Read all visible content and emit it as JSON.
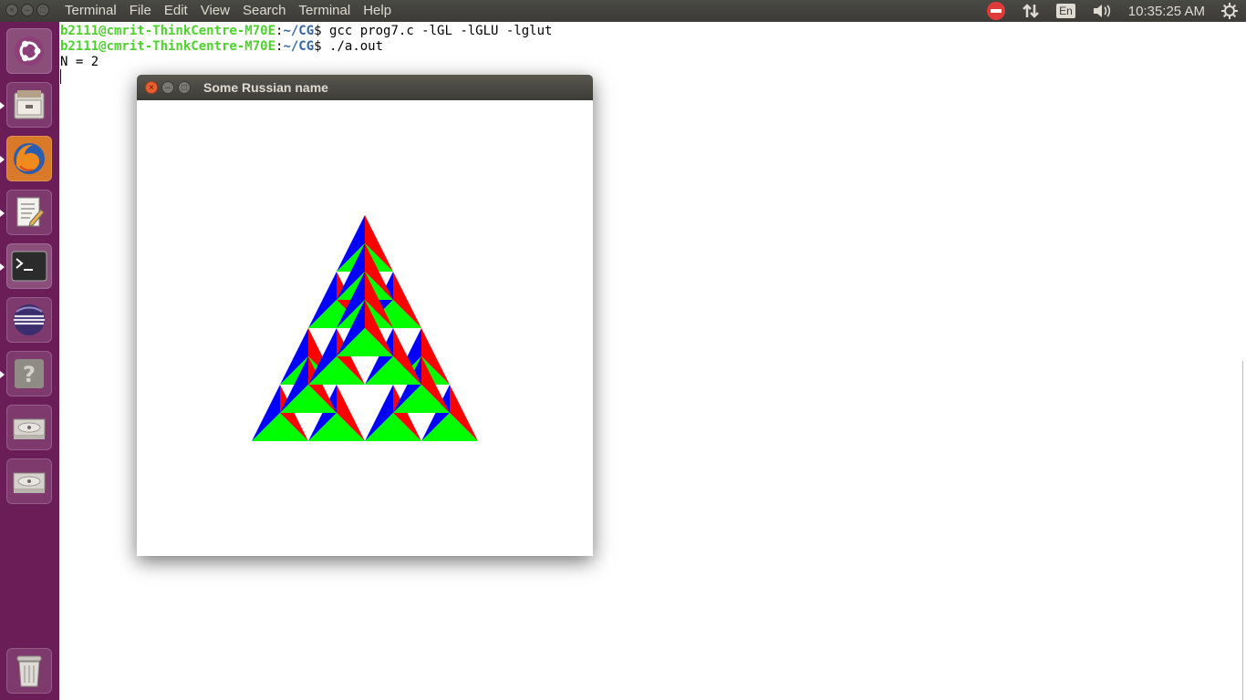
{
  "top_panel": {
    "menus": [
      "Terminal",
      "File",
      "Edit",
      "View",
      "Search",
      "Terminal",
      "Help"
    ],
    "language": "En",
    "clock": "10:35:25 AM"
  },
  "launcher": {
    "items": [
      "ubuntu-dash-icon",
      "files-icon",
      "firefox-icon",
      "text-editor-icon",
      "terminal-icon",
      "eclipse-icon",
      "help-icon",
      "drive-icon",
      "drive-icon",
      "trash-icon"
    ]
  },
  "terminal": {
    "lines": [
      {
        "user": "b2111@cmrit-ThinkCentre-M70E",
        "sep": ":",
        "path": "~/CG",
        "prompt": "$ ",
        "command": "gcc prog7.c -lGL -lGLU -lglut"
      },
      {
        "user": "b2111@cmrit-ThinkCentre-M70E",
        "sep": ":",
        "path": "~/CG",
        "prompt": "$ ",
        "command": "./a.out"
      },
      {
        "output": "N = 2"
      }
    ]
  },
  "glut_window": {
    "title": "Some Russian name"
  },
  "colors": {
    "face_left": "#0000ff",
    "face_right": "#ff0000",
    "face_bottom": "#00ff00"
  }
}
